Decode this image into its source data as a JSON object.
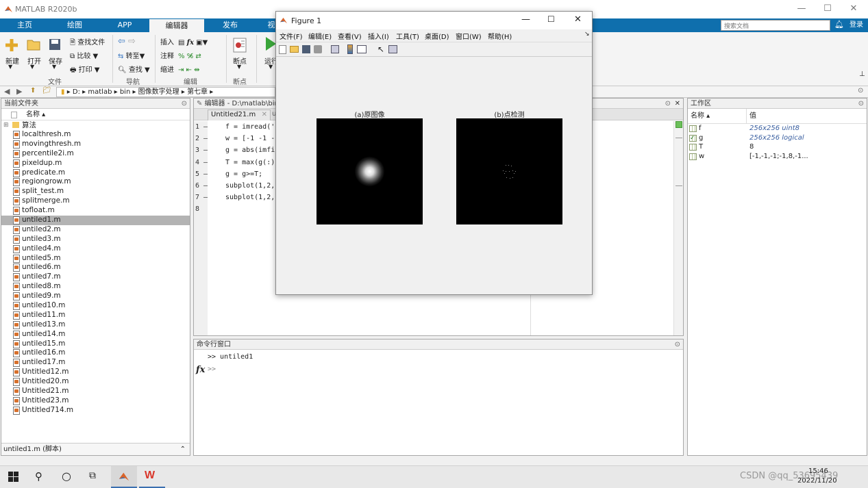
{
  "app": {
    "title": "MATLAB R2020b"
  },
  "tabs": [
    {
      "label": "主页"
    },
    {
      "label": "绘图"
    },
    {
      "label": "APP"
    },
    {
      "label": "编辑器"
    },
    {
      "label": "发布"
    },
    {
      "label": "视"
    }
  ],
  "search": {
    "placeholder": "搜索文档"
  },
  "login": "登录",
  "ribbon": {
    "new": "新建",
    "open": "打开",
    "save": "保存",
    "find_files": "查找文件",
    "compare": "比较",
    "print": "打印",
    "goto": "转至",
    "find": "查找",
    "insert": "插入",
    "comment": "注释",
    "indent": "缩进",
    "breakpoints": "断点",
    "run": "运行",
    "groups": {
      "file": "文件",
      "navigate": "导航",
      "edit": "编辑",
      "breakpoints": "断点"
    }
  },
  "path": [
    "D:",
    "matlab",
    "bin",
    "图像数字处理",
    "第七章"
  ],
  "current_folder": {
    "title": "当前文件夹",
    "col_name": "名称",
    "folder": "算法",
    "files": [
      "localthresh.m",
      "movingthresh.m",
      "percentile2i.m",
      "pixeldup.m",
      "predicate.m",
      "regiongrow.m",
      "split_test.m",
      "splitmerge.m",
      "tofloat.m",
      "untiled1.m",
      "untiled2.m",
      "untiled3.m",
      "untiled4.m",
      "untiled5.m",
      "untiled6.m",
      "untiled7.m",
      "untiled8.m",
      "untiled9.m",
      "untiled10.m",
      "untiled11.m",
      "untiled13.m",
      "untiled14.m",
      "untiled15.m",
      "untiled16.m",
      "untiled17.m",
      "Untitled12.m",
      "Untitled20.m",
      "Untitled21.m",
      "Untitled23.m",
      "Untitled714.m"
    ],
    "selected_index": 9,
    "details": "untiled1.m  (脚本)"
  },
  "editor": {
    "title": "编辑器 - D:\\matlab\\bin",
    "tab": "Untitled21.m",
    "tab2": "u",
    "lines": [
      {
        "num": "1 —",
        "code": "f = imread('I"
      },
      {
        "num": "2 —",
        "code": "w = [-1 -1 -"
      },
      {
        "num": "3 —",
        "code": "g = abs(imfi"
      },
      {
        "num": "4 —",
        "code": "T = max(g(:)"
      },
      {
        "num": "5 —",
        "code": "g = g>=T;"
      },
      {
        "num": "6 —",
        "code": "subplot(1,2,1"
      },
      {
        "num": "7 —",
        "code": "subplot(1,2,2"
      },
      {
        "num": "8",
        "code": ""
      }
    ]
  },
  "command_window": {
    "title": "命令行窗口",
    "history": ">> untiled1",
    "prompt": ">>",
    "fx": "fx"
  },
  "workspace": {
    "title": "工作区",
    "col_name": "名称",
    "col_value": "值",
    "vars": [
      {
        "name": "f",
        "value": "256x256 uint8",
        "italic": true
      },
      {
        "name": "g",
        "value": "256x256 logical",
        "italic": true
      },
      {
        "name": "T",
        "value": "8",
        "italic": false
      },
      {
        "name": "w",
        "value": "[-1,-1,-1;-1,8,-1...",
        "italic": false
      }
    ]
  },
  "figure": {
    "title": "Figure 1",
    "menu": [
      "文件(F)",
      "编辑(E)",
      "查看(V)",
      "插入(I)",
      "工具(T)",
      "桌面(D)",
      "窗口(W)",
      "帮助(H)"
    ],
    "subplot1_title": "(a)原图像",
    "subplot2_title": "(b)点检测"
  },
  "taskbar": {
    "time": "15:46",
    "date": "2022/11/20",
    "watermark": "CSDN @qq_53695439"
  }
}
